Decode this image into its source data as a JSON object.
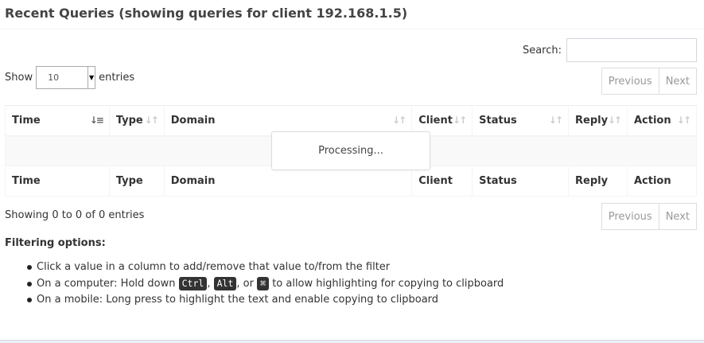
{
  "header": {
    "title": "Recent Queries (showing queries for client 192.168.1.5)"
  },
  "search": {
    "label": "Search:",
    "value": "",
    "placeholder": ""
  },
  "length": {
    "prefix": "Show",
    "selected": "10",
    "suffix": "entries"
  },
  "pager": {
    "previous": "Previous",
    "next": "Next"
  },
  "table": {
    "columns": [
      "Time",
      "Type",
      "Domain",
      "Client",
      "Status",
      "Reply",
      "Action"
    ],
    "sort_column": "Time",
    "rows": []
  },
  "processing": "Processing...",
  "info": "Showing 0 to 0 of 0 entries",
  "filtering": {
    "title": "Filtering options:",
    "item1": "Click a value in a column to add/remove that value to/from the filter",
    "item2_prefix": "On a computer: Hold down",
    "key_ctrl": "Ctrl",
    "sep_comma": ",",
    "key_alt": "Alt",
    "sep_or": ", or",
    "key_cmd": "⌘",
    "item2_suffix": "to allow highlighting for copying to clipboard",
    "item3": "On a mobile: Long press to highlight the text and enable copying to clipboard"
  },
  "icons": {
    "sort_active": "sort-amount-desc-icon",
    "sort_inactive": "sort-both-icon"
  }
}
